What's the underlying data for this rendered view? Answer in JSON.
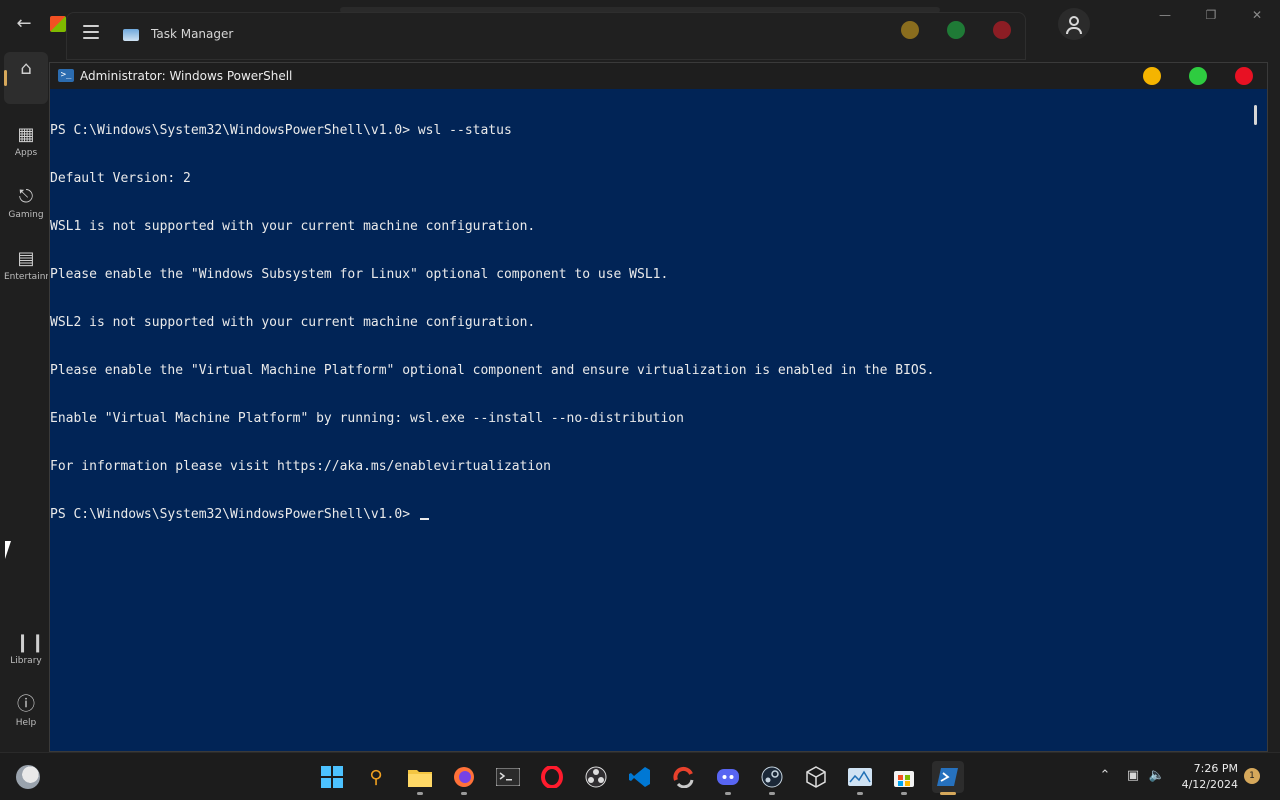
{
  "store": {
    "nav": [
      {
        "label": ""
      },
      {
        "label": "Apps"
      },
      {
        "label": "Gaming"
      },
      {
        "label": "Entertainment"
      },
      {
        "label": "Library"
      },
      {
        "label": "Help"
      }
    ]
  },
  "task_manager": {
    "title": "Task Manager"
  },
  "powershell": {
    "title": "Administrator: Windows PowerShell",
    "lines": [
      "PS C:\\Windows\\System32\\WindowsPowerShell\\v1.0> wsl --status",
      "Default Version: 2",
      "WSL1 is not supported with your current machine configuration.",
      "Please enable the \"Windows Subsystem for Linux\" optional component to use WSL1.",
      "WSL2 is not supported with your current machine configuration.",
      "Please enable the \"Virtual Machine Platform\" optional component and ensure virtualization is enabled in the BIOS.",
      "Enable \"Virtual Machine Platform\" by running: wsl.exe --install --no-distribution",
      "For information please visit https://aka.ms/enablevirtualization"
    ],
    "prompt": "PS C:\\Windows\\System32\\WindowsPowerShell\\v1.0> "
  },
  "taskbar": {
    "time": "7:26 PM",
    "date": "4/12/2024",
    "notification_count": "1"
  },
  "colors": {
    "ps_background": "#012456",
    "accent": "#d6a85b",
    "close": "#e81123",
    "minimize": "#f5b400",
    "maximize": "#2ecc40"
  }
}
